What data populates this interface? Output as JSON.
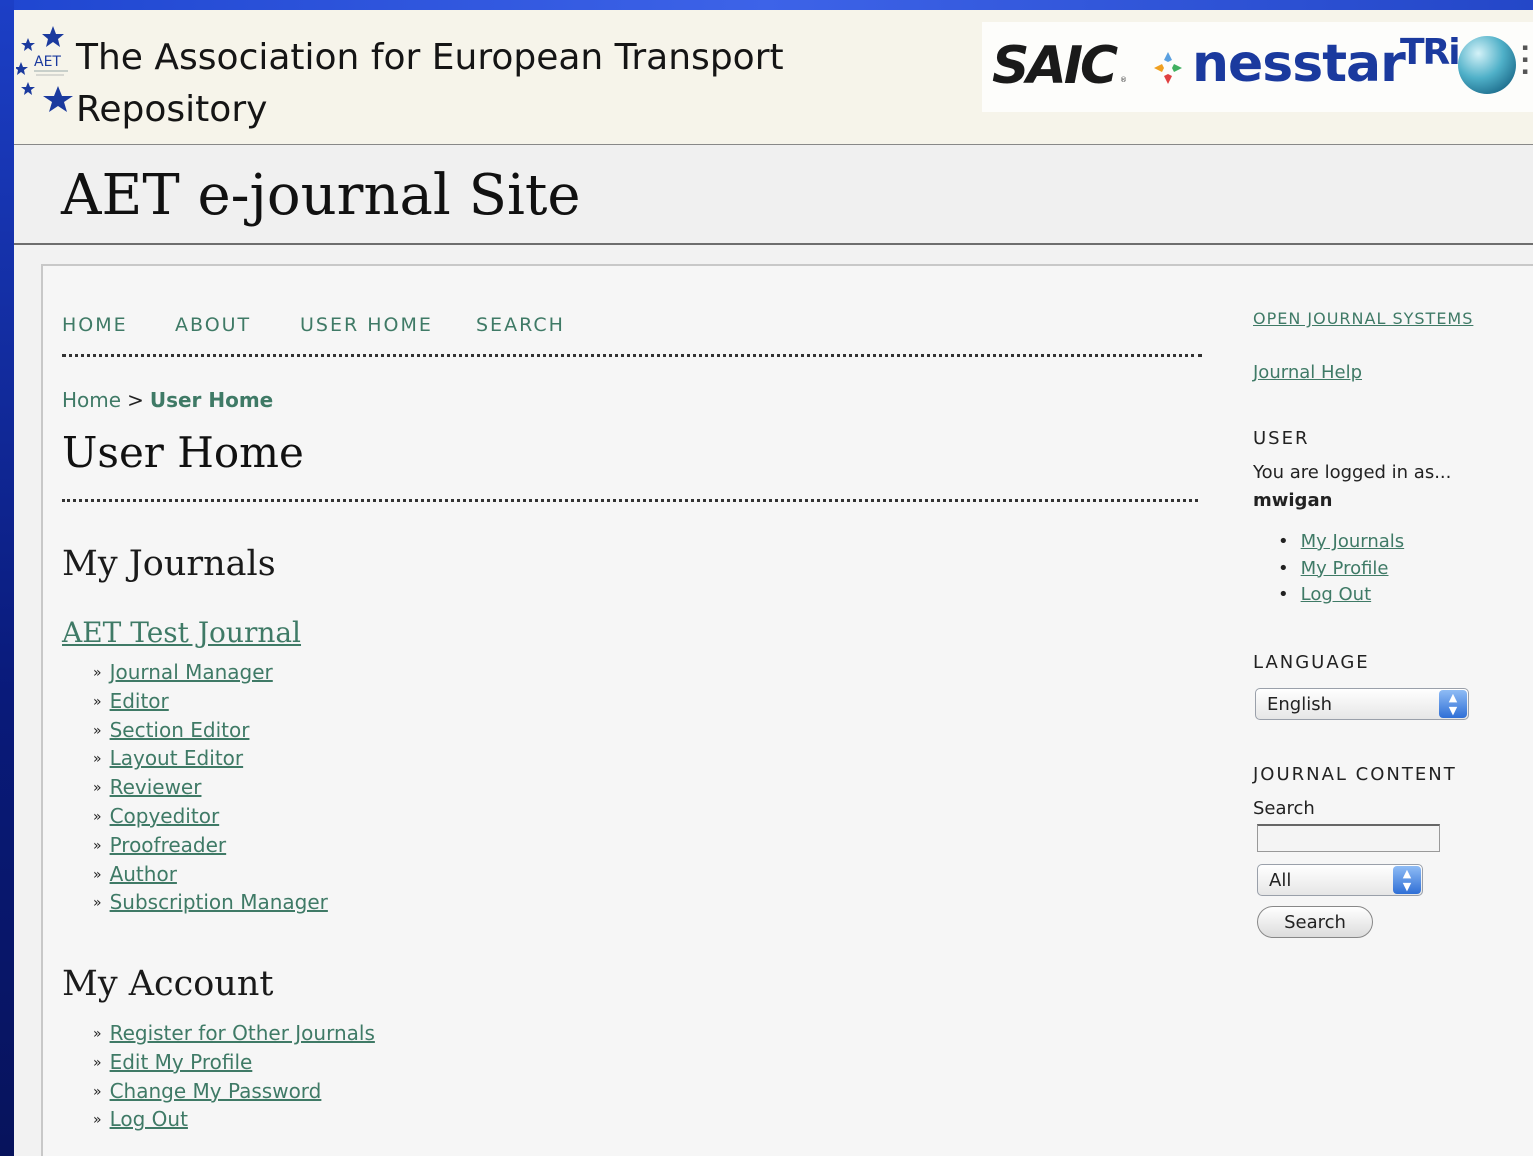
{
  "header": {
    "association_title": "The Association for European Transport Repository",
    "aet_logo_text": "AET",
    "sponsors": {
      "saic": "SAIC",
      "nesstar": "nesstar",
      "tri": "TRi"
    },
    "site_title": "AET e-journal Site"
  },
  "nav": {
    "items": [
      "HOME",
      "ABOUT",
      "USER HOME",
      "SEARCH"
    ]
  },
  "breadcrumb": {
    "home": "Home",
    "separator": ">",
    "current": "User Home"
  },
  "main": {
    "page_title": "User Home",
    "my_journals": {
      "heading": "My Journals",
      "journal_name": "AET Test Journal",
      "roles": [
        "Journal Manager",
        "Editor",
        "Section Editor",
        "Layout Editor",
        "Reviewer",
        "Copyeditor",
        "Proofreader",
        "Author",
        "Subscription Manager"
      ]
    },
    "my_account": {
      "heading": "My Account",
      "links": [
        "Register for Other Journals",
        "Edit My Profile",
        "Change My Password",
        "Log Out"
      ]
    }
  },
  "sidebar": {
    "ojs_link": "OPEN JOURNAL SYSTEMS",
    "help_link": "Journal Help",
    "user": {
      "heading": "USER",
      "logged_in_text": "You are logged in as...",
      "username": "mwigan",
      "links": [
        "My Journals",
        "My Profile",
        "Log Out"
      ]
    },
    "language": {
      "heading": "LANGUAGE",
      "selected": "English"
    },
    "journal_content": {
      "heading": "JOURNAL CONTENT",
      "search_label": "Search",
      "search_value": "",
      "scope_selected": "All",
      "search_button": "Search"
    }
  },
  "colors": {
    "link": "#3f7a66",
    "accent_blue": "#1b3a9e",
    "frame": "#0a1f8a"
  }
}
